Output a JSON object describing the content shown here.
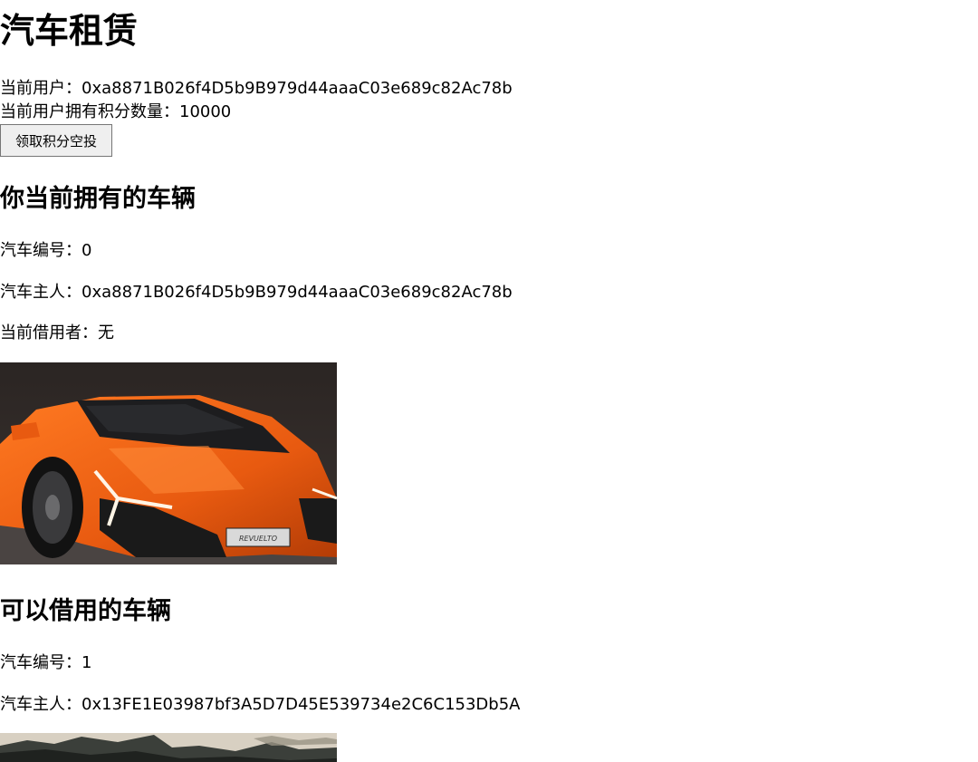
{
  "app": {
    "title": "汽车租赁"
  },
  "user": {
    "address_label": "当前用户：",
    "address": "0xa8871B026f4D5b9B979d44aaaC03e689c82Ac78b",
    "points_label": "当前用户拥有积分数量：",
    "points": "10000",
    "airdrop_button": "领取积分空投"
  },
  "owned_section": {
    "title": "你当前拥有的车辆",
    "cars": [
      {
        "id_label": "汽车编号：",
        "id": "0",
        "owner_label": "汽车主人：",
        "owner": "0xa8871B026f4D5b9B979d44aaaC03e689c82Ac78b",
        "borrower_label": "当前借用者：",
        "borrower": "无",
        "plate_text": "REVUELTO"
      }
    ]
  },
  "available_section": {
    "title": "可以借用的车辆",
    "cars": [
      {
        "id_label": "汽车编号：",
        "id": "1",
        "owner_label": "汽车主人：",
        "owner": "0x13FE1E03987bf3A5D7D45E539734e2C6C153Db5A"
      }
    ]
  }
}
